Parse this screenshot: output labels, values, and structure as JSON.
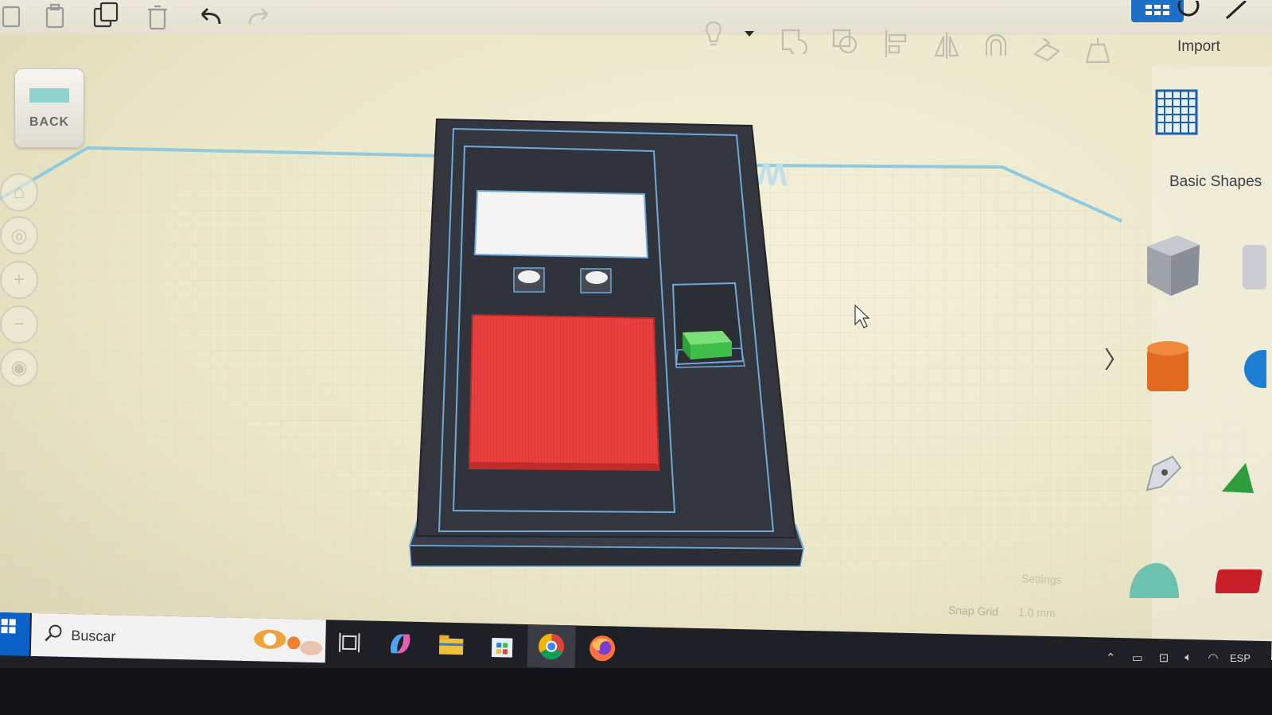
{
  "toolbar": {
    "icons": [
      "copy-icon",
      "paste-icon",
      "duplicate-icon",
      "delete-icon",
      "undo-icon",
      "redo-icon"
    ],
    "import_label": "Import"
  },
  "toolbar2": {
    "icons": [
      "light-bulb-icon",
      "dropdown-arrow-icon",
      "group-icon",
      "ungroup-icon",
      "align-icon",
      "mirror-icon",
      "magnet-icon",
      "workplane-icon",
      "ruler-icon"
    ]
  },
  "left_nav": {
    "view_cube_label": "BACK",
    "buttons": [
      "home-view-icon",
      "fit-view-icon",
      "zoom-in-icon",
      "zoom-out-icon",
      "perspective-icon"
    ]
  },
  "workplane": {
    "label": "Workplane",
    "snap_grid_label": "Snap Grid",
    "snap_grid_value": "1.0 mm",
    "settings_label": "Settings"
  },
  "right_panel": {
    "category_label": "Basic Shapes",
    "shapes": [
      "box-shape",
      "cylinder-shape",
      "text-shape",
      "roof-shape",
      "half-sphere-shape",
      "scribble-shape"
    ]
  },
  "taskbar": {
    "search_placeholder": "Buscar",
    "apps": [
      "task-view-icon",
      "copilot-icon",
      "file-explorer-icon",
      "store-icon",
      "chrome-icon",
      "firefox-icon"
    ],
    "language": "ESP"
  },
  "colors": {
    "accent_blue": "#1e6fc8",
    "model_body": "#33363f",
    "model_outline": "#6fa9d9",
    "red_panel": "#e8403f",
    "green_part": "#3fbf4a",
    "white_screen": "#f4f4f4",
    "workplane": "#ece7c8"
  }
}
